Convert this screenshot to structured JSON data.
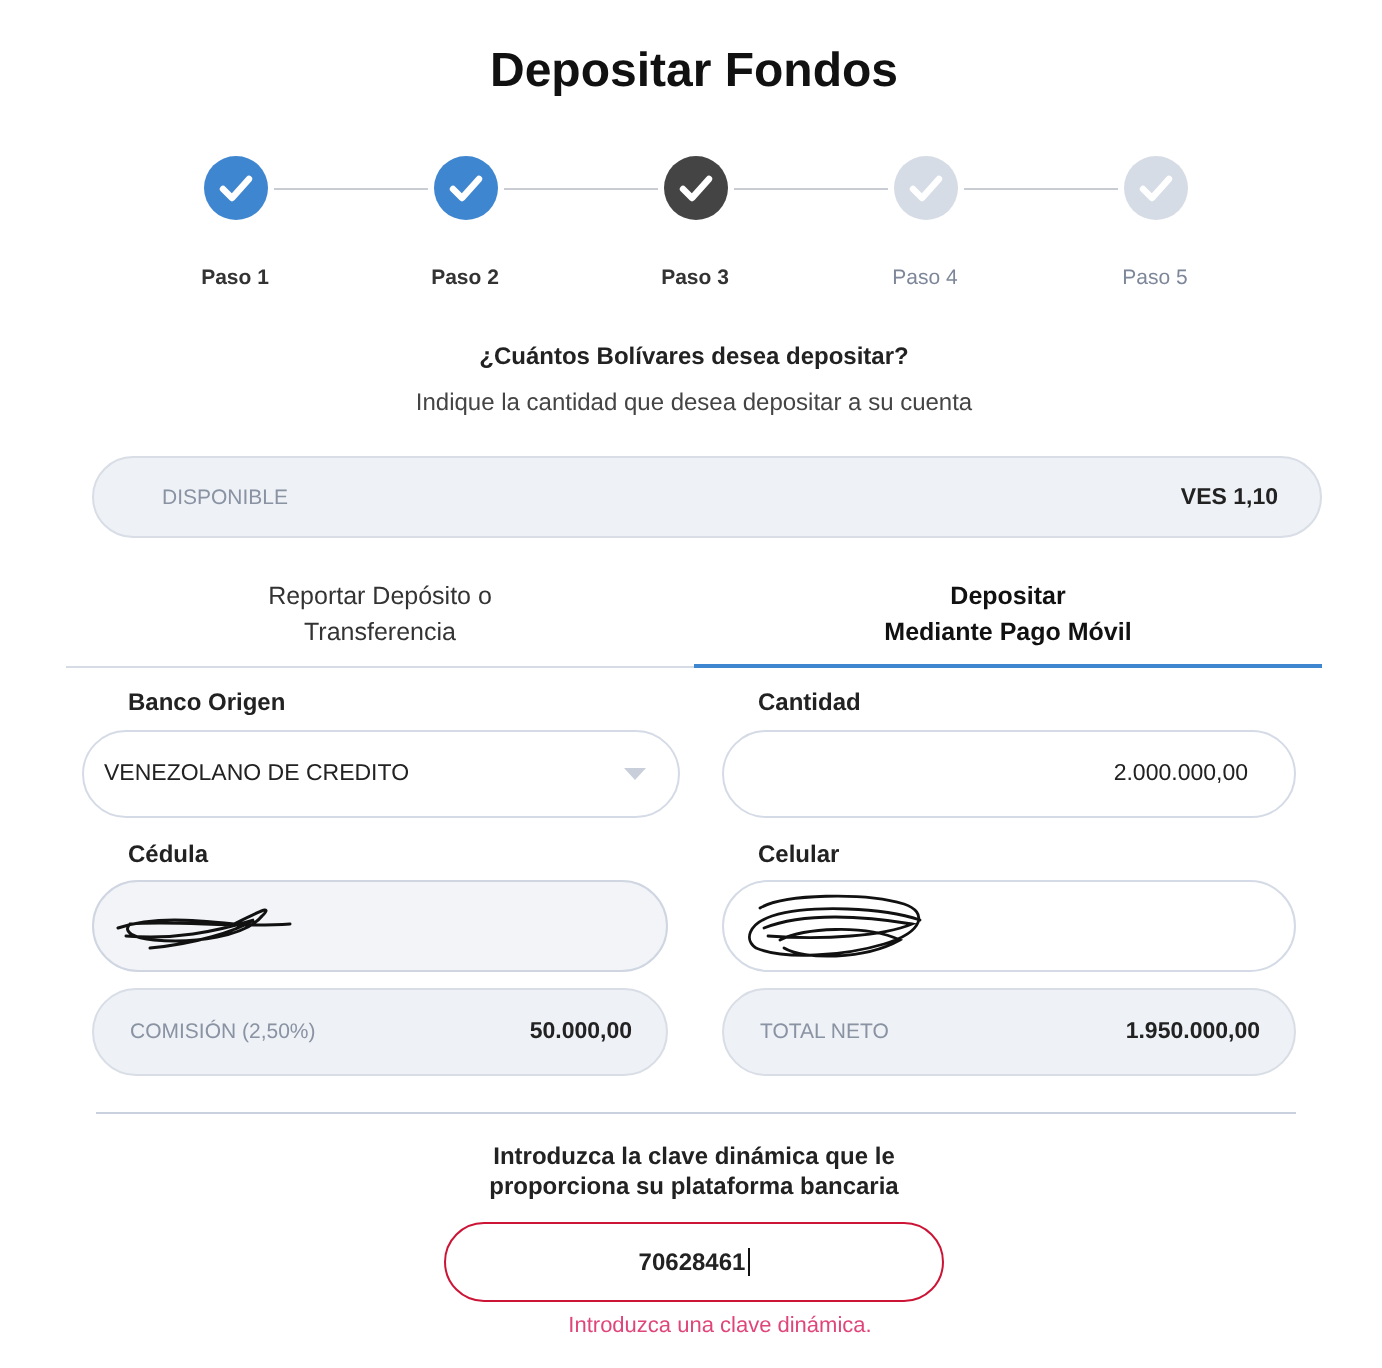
{
  "title": "Depositar Fondos",
  "steps": [
    {
      "label": "Paso 1",
      "kind": "complete"
    },
    {
      "label": "Paso 2",
      "kind": "complete"
    },
    {
      "label": "Paso 3",
      "kind": "current"
    },
    {
      "label": "Paso 4",
      "kind": "pending"
    },
    {
      "label": "Paso 5",
      "kind": "pending"
    }
  ],
  "question": "¿Cuántos Bolívares desea depositar?",
  "instructions": "Indique la cantidad que desea depositar a su cuenta",
  "available": {
    "label": "DISPONIBLE",
    "value": "VES 1,10"
  },
  "tabs": [
    {
      "lines": [
        "Reportar Depósito o",
        "Transferencia"
      ],
      "selected": false
    },
    {
      "lines": [
        "Depositar",
        "Mediante Pago Móvil"
      ],
      "selected": true
    }
  ],
  "fields": [
    {
      "kind": "select",
      "label": "Banco Origen",
      "value": "VENEZOLANO DE CREDITO",
      "disabled": false,
      "redacted": false
    },
    {
      "kind": "amount",
      "label": "Cantidad",
      "value": "2.000.000,00",
      "disabled": false,
      "redacted": false
    },
    {
      "kind": "text",
      "label": "Cédula",
      "disabled": true,
      "redacted": true
    },
    {
      "kind": "text",
      "label": "Celular",
      "disabled": false,
      "redacted": true
    }
  ],
  "summary": [
    {
      "label": "COMISIÓN (2,50%)",
      "value": "50.000,00"
    },
    {
      "label": "TOTAL NETO",
      "value": "1.950.000,00"
    }
  ],
  "key_entry": {
    "prompt": "Introduzca la clave dinámica que le proporciona su plataforma bancaria",
    "value": "70628461",
    "focused": true,
    "invalid": true,
    "error": "Introduzca una clave dinámica."
  }
}
